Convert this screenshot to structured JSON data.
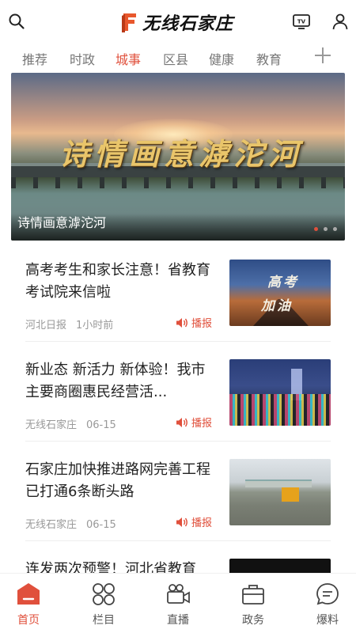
{
  "header": {
    "app_name": "无线石家庄",
    "icons": {
      "search": "search-icon",
      "tv": "tv-icon",
      "user": "user-icon"
    }
  },
  "tabs": [
    {
      "label": "推荐",
      "active": false
    },
    {
      "label": "时政",
      "active": false
    },
    {
      "label": "城事",
      "active": true
    },
    {
      "label": "区县",
      "active": false
    },
    {
      "label": "健康",
      "active": false
    },
    {
      "label": "教育",
      "active": false
    }
  ],
  "banner": {
    "calligraphy": "诗情画意滹沱河",
    "caption": "诗情画意滹沱河",
    "slide_count": 3,
    "active_slide": 1
  },
  "news": [
    {
      "title": "高考考生和家长注意！省教育考试院来信啦",
      "source": "河北日报",
      "time": "1小时前",
      "play_label": "播报",
      "thumb_text": [
        "高考",
        "加油"
      ]
    },
    {
      "title": "新业态 新活力 新体验！我市主要商圈惠民经营活...",
      "source": "无线石家庄",
      "time": "06-15",
      "play_label": "播报"
    },
    {
      "title": "石家庄加快推进路网完善工程 已打通6条断头路",
      "source": "无线石家庄",
      "time": "06-15",
      "play_label": "播报"
    },
    {
      "title": "连发两次预警！河北省教育"
    }
  ],
  "bottom_nav": [
    {
      "label": "首页",
      "icon": "home-icon",
      "active": true
    },
    {
      "label": "栏目",
      "icon": "grid-icon",
      "active": false
    },
    {
      "label": "直播",
      "icon": "video-camera-icon",
      "active": false
    },
    {
      "label": "政务",
      "icon": "briefcase-icon",
      "active": false
    },
    {
      "label": "爆料",
      "icon": "chat-bubble-icon",
      "active": false
    }
  ],
  "colors": {
    "accent": "#e0503c",
    "text": "#222222",
    "muted": "#999999",
    "logo_orange": "#e8572c"
  }
}
